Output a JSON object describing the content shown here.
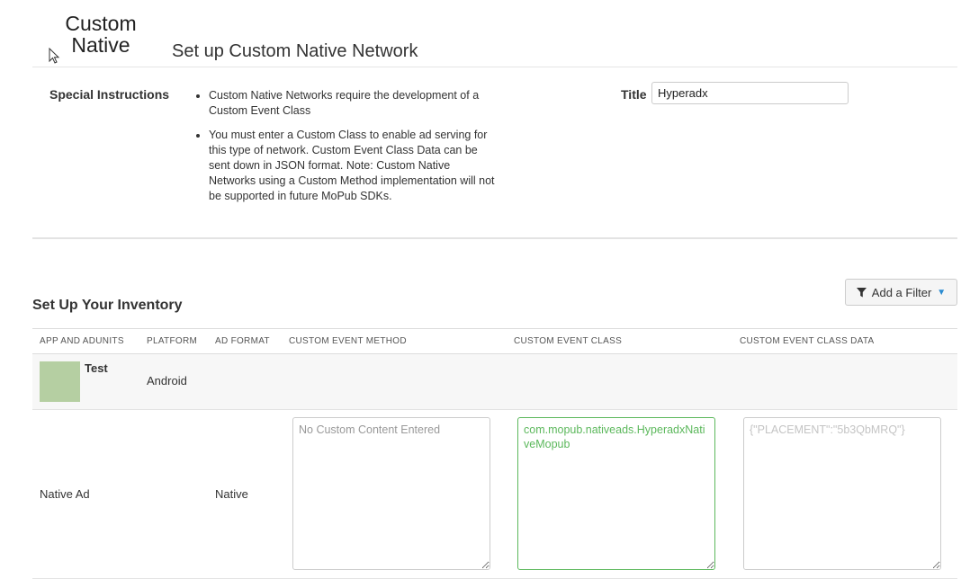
{
  "logo": {
    "line1": "Custom",
    "line2": "Native"
  },
  "page_title": "Set up Custom Native Network",
  "special_instructions": {
    "label": "Special Instructions",
    "items": [
      "Custom Native Networks require the development of a Custom Event Class",
      "You must enter a Custom Class to enable ad serving for this type of network. Custom Event Class Data can be sent down in JSON format. Note: Custom Native Networks using a Custom Method implementation will not be supported in future MoPub SDKs."
    ]
  },
  "title_field": {
    "label": "Title",
    "value": "Hyperadx"
  },
  "inventory": {
    "title": "Set Up Your Inventory",
    "filter_button": "Add a Filter"
  },
  "table": {
    "headers": [
      "APP AND ADUNITS",
      "PLATFORM",
      "AD FORMAT",
      "CUSTOM EVENT METHOD",
      "CUSTOM EVENT CLASS",
      "CUSTOM EVENT CLASS DATA"
    ],
    "app": {
      "name": "Test",
      "platform": "Android"
    },
    "adunit": {
      "name": "Native Ad",
      "format": "Native",
      "custom_event_method_placeholder": "No Custom Content Entered",
      "custom_event_class_value": "com.mopub.nativeads.HyperadxNativeMopub",
      "custom_event_class_data_placeholder": "{\"PLACEMENT\":\"5b3QbMRQ\"}"
    }
  },
  "colors": {
    "accent_green": "#5cb85c",
    "caret_blue": "#2a8bd1",
    "app_icon": "#b5cfa2"
  },
  "icons": {
    "filter": "filter-icon",
    "caret": "caret-down-icon",
    "cursor": "mouse-pointer-icon"
  }
}
